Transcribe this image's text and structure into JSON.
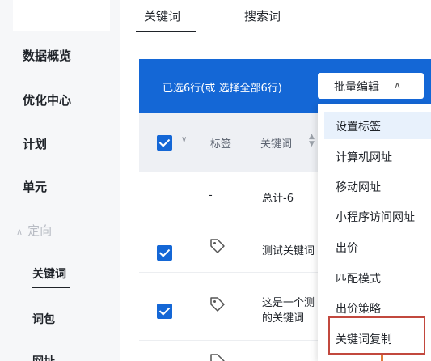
{
  "sidebar": {
    "items": [
      {
        "label": "数据概览"
      },
      {
        "label": "优化中心"
      },
      {
        "label": "计划"
      },
      {
        "label": "单元"
      }
    ],
    "section": {
      "label": "定向",
      "expanded": true
    },
    "sub_items": [
      {
        "label": "关键词",
        "active": true
      },
      {
        "label": "词包"
      },
      {
        "label": "网址"
      }
    ]
  },
  "tabs": [
    {
      "label": "关键词",
      "active": true
    },
    {
      "label": "搜索词",
      "active": false
    }
  ],
  "batch_bar": {
    "selected_text": "已选6行(或 选择全部6行)",
    "button_label": "批量编辑",
    "accent": "#1467d6"
  },
  "table": {
    "headers": {
      "tag": "标签",
      "keyword": "关键词"
    },
    "rows": [
      {
        "tag": "-",
        "keyword": "总计-6",
        "checked": false
      },
      {
        "keyword": "测试关键词",
        "checked": true
      },
      {
        "keyword_line1": "这是一个测",
        "keyword_line2": "的关键词",
        "checked": true
      },
      {
        "checked": false
      }
    ]
  },
  "dropdown": {
    "items": [
      {
        "label": "设置标签",
        "highlighted": true
      },
      {
        "label": "计算机网址"
      },
      {
        "label": "移动网址"
      },
      {
        "label": "小程序访问网址"
      },
      {
        "label": "出价"
      },
      {
        "label": "匹配模式"
      },
      {
        "label": "出价策略"
      },
      {
        "label": "关键词复制",
        "boxed": true
      }
    ],
    "box_color": "#c2483e"
  }
}
